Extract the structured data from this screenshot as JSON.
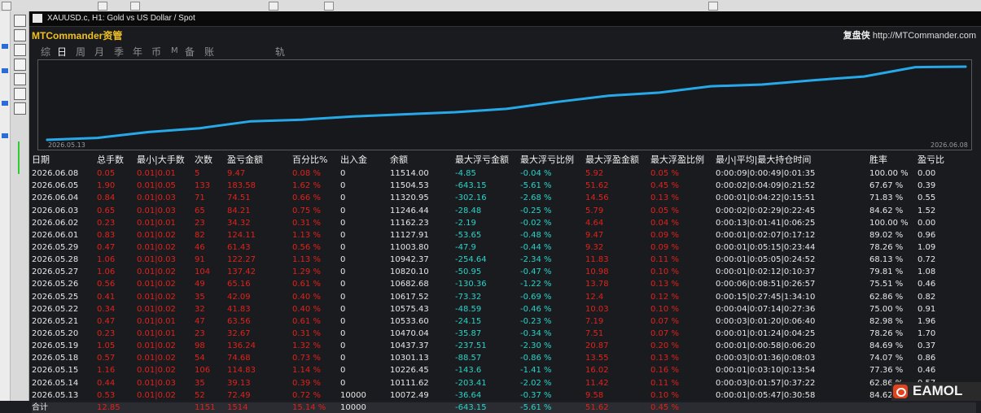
{
  "window": {
    "title": "XAUUSD.c, H1: Gold vs US Dollar / Spot"
  },
  "panel": {
    "brand": "MTCommander资管",
    "brand_right_name": "复盘侠",
    "brand_right_url": "http://MTCommander.com",
    "tabs": [
      {
        "label": "综",
        "active": false
      },
      {
        "label": "日",
        "active": true
      },
      {
        "label": "周",
        "active": false
      },
      {
        "label": "月",
        "active": false
      },
      {
        "label": "季",
        "active": false
      },
      {
        "label": "年",
        "active": false
      },
      {
        "label": "币",
        "active": false
      },
      {
        "label": "M",
        "active": false
      },
      {
        "label": "备",
        "active": false
      },
      {
        "label": "账户",
        "active": false
      },
      {
        "label": "轨迹",
        "active": false
      }
    ]
  },
  "chart_data": {
    "type": "line",
    "x_start_label": "2026.05.13",
    "x_end_label": "2026.06.08",
    "color": "#27a9e8",
    "x": [
      "2026.05.13",
      "2026.05.14",
      "2026.05.15",
      "2026.05.18",
      "2026.05.19",
      "2026.05.20",
      "2026.05.21",
      "2026.05.22",
      "2026.05.25",
      "2026.05.26",
      "2026.05.27",
      "2026.05.28",
      "2026.05.29",
      "2026.06.01",
      "2026.06.02",
      "2026.06.03",
      "2026.06.04",
      "2026.06.05",
      "2026.06.08"
    ],
    "values": [
      10072.49,
      10111.62,
      10226.45,
      10301.13,
      10437.37,
      10470.04,
      10533.6,
      10575.43,
      10617.52,
      10682.68,
      10820.1,
      10942.37,
      11003.8,
      11127.91,
      11162.23,
      11246.44,
      11320.95,
      11504.53,
      11514.0
    ]
  },
  "table": {
    "headers": [
      "日期",
      "总手数",
      "最小|大手数",
      "次数",
      "盈亏金额",
      "百分比%",
      "出入金",
      "余额",
      "最大浮亏金额",
      "最大浮亏比例",
      "最大浮盈金额",
      "最大浮盈比例",
      "最小|平均|最大持仓时间",
      "胜率",
      "盈亏比"
    ],
    "rows": [
      [
        "2026.06.08",
        "0.05",
        "0.01|0.01",
        "5",
        "9.47",
        "0.08 %",
        "0",
        "11514.00",
        "-4.85",
        "-0.04 %",
        "5.92",
        "0.05 %",
        "0:00:09|0:00:49|0:01:35",
        "100.00 %",
        "0.00"
      ],
      [
        "2026.06.05",
        "1.90",
        "0.01|0.05",
        "133",
        "183.58",
        "1.62 %",
        "0",
        "11504.53",
        "-643.15",
        "-5.61 %",
        "51.62",
        "0.45 %",
        "0:00:02|0:04:09|0:21:52",
        "67.67 %",
        "0.39"
      ],
      [
        "2026.06.04",
        "0.84",
        "0.01|0.03",
        "71",
        "74.51",
        "0.66 %",
        "0",
        "11320.95",
        "-302.16",
        "-2.68 %",
        "14.56",
        "0.13 %",
        "0:00:01|0:04:22|0:15:51",
        "71.83 %",
        "0.55"
      ],
      [
        "2026.06.03",
        "0.65",
        "0.01|0.03",
        "65",
        "84.21",
        "0.75 %",
        "0",
        "11246.44",
        "-28.48",
        "-0.25 %",
        "5.79",
        "0.05 %",
        "0:00:02|0:02:29|0:22:45",
        "84.62 %",
        "1.52"
      ],
      [
        "2026.06.02",
        "0.23",
        "0.01|0.01",
        "23",
        "34.32",
        "0.31 %",
        "0",
        "11162.23",
        "-2.19",
        "-0.02 %",
        "4.64",
        "0.04 %",
        "0:00:13|0:01:41|0:06:25",
        "100.00 %",
        "0.00"
      ],
      [
        "2026.06.01",
        "0.83",
        "0.01|0.02",
        "82",
        "124.11",
        "1.13 %",
        "0",
        "11127.91",
        "-53.65",
        "-0.48 %",
        "9.47",
        "0.09 %",
        "0:00:01|0:02:07|0:17:12",
        "89.02 %",
        "0.96"
      ],
      [
        "2026.05.29",
        "0.47",
        "0.01|0.02",
        "46",
        "61.43",
        "0.56 %",
        "0",
        "11003.80",
        "-47.9",
        "-0.44 %",
        "9.32",
        "0.09 %",
        "0:00:01|0:05:15|0:23:44",
        "78.26 %",
        "1.09"
      ],
      [
        "2026.05.28",
        "1.06",
        "0.01|0.03",
        "91",
        "122.27",
        "1.13 %",
        "0",
        "10942.37",
        "-254.64",
        "-2.34 %",
        "11.83",
        "0.11 %",
        "0:00:01|0:05:05|0:24:52",
        "68.13 %",
        "0.72"
      ],
      [
        "2026.05.27",
        "1.06",
        "0.01|0.02",
        "104",
        "137.42",
        "1.29 %",
        "0",
        "10820.10",
        "-50.95",
        "-0.47 %",
        "10.98",
        "0.10 %",
        "0:00:01|0:02:12|0:10:37",
        "79.81 %",
        "1.08"
      ],
      [
        "2026.05.26",
        "0.56",
        "0.01|0.02",
        "49",
        "65.16",
        "0.61 %",
        "0",
        "10682.68",
        "-130.36",
        "-1.22 %",
        "13.78",
        "0.13 %",
        "0:00:06|0:08:51|0:26:57",
        "75.51 %",
        "0.46"
      ],
      [
        "2026.05.25",
        "0.41",
        "0.01|0.02",
        "35",
        "42.09",
        "0.40 %",
        "0",
        "10617.52",
        "-73.32",
        "-0.69 %",
        "12.4",
        "0.12 %",
        "0:00:15|0:27:45|1:34:10",
        "62.86 %",
        "0.82"
      ],
      [
        "2026.05.22",
        "0.34",
        "0.01|0.02",
        "32",
        "41.83",
        "0.40 %",
        "0",
        "10575.43",
        "-48.59",
        "-0.46 %",
        "10.03",
        "0.10 %",
        "0:00:04|0:07:14|0:27:36",
        "75.00 %",
        "0.91"
      ],
      [
        "2026.05.21",
        "0.47",
        "0.01|0.01",
        "47",
        "63.56",
        "0.61 %",
        "0",
        "10533.60",
        "-24.15",
        "-0.23 %",
        "7.19",
        "0.07 %",
        "0:00:03|0:01:20|0:06:40",
        "82.98 %",
        "1.96"
      ],
      [
        "2026.05.20",
        "0.23",
        "0.01|0.01",
        "23",
        "32.67",
        "0.31 %",
        "0",
        "10470.04",
        "-35.87",
        "-0.34 %",
        "7.51",
        "0.07 %",
        "0:00:01|0:01:24|0:04:25",
        "78.26 %",
        "1.70"
      ],
      [
        "2026.05.19",
        "1.05",
        "0.01|0.02",
        "98",
        "136.24",
        "1.32 %",
        "0",
        "10437.37",
        "-237.51",
        "-2.30 %",
        "20.87",
        "0.20 %",
        "0:00:01|0:00:58|0:06:20",
        "84.69 %",
        "0.37"
      ],
      [
        "2026.05.18",
        "0.57",
        "0.01|0.02",
        "54",
        "74.68",
        "0.73 %",
        "0",
        "10301.13",
        "-88.57",
        "-0.86 %",
        "13.55",
        "0.13 %",
        "0:00:03|0:01:36|0:08:03",
        "74.07 %",
        "0.86"
      ],
      [
        "2026.05.15",
        "1.16",
        "0.01|0.02",
        "106",
        "114.83",
        "1.14 %",
        "0",
        "10226.45",
        "-143.6",
        "-1.41 %",
        "16.02",
        "0.16 %",
        "0:00:01|0:03:10|0:13:54",
        "77.36 %",
        "0.46"
      ],
      [
        "2026.05.14",
        "0.44",
        "0.01|0.03",
        "35",
        "39.13",
        "0.39 %",
        "0",
        "10111.62",
        "-203.41",
        "-2.02 %",
        "11.42",
        "0.11 %",
        "0:00:03|0:01:57|0:37:22",
        "62.86 %",
        "0.57"
      ],
      [
        "2026.05.13",
        "0.53",
        "0.01|0.02",
        "52",
        "72.49",
        "0.72 %",
        "10000",
        "10072.49",
        "-36.64",
        "-0.37 %",
        "9.58",
        "0.10 %",
        "0:00:01|0:05:47|0:30:58",
        "84.62 %",
        "1.27"
      ]
    ],
    "totals": [
      "合计",
      "12.85",
      "",
      "1151",
      "1514",
      "15.14 %",
      "10000",
      "",
      "-643.15",
      "-5.61 %",
      "51.62",
      "0.45 %",
      "",
      "",
      ""
    ]
  },
  "watermark": "EAMOL",
  "colors": {
    "red": "#e2221a",
    "teal": "#28d4c8",
    "white": "#e8e8e8",
    "brand": "#f0c020",
    "line": "#27a9e8"
  }
}
